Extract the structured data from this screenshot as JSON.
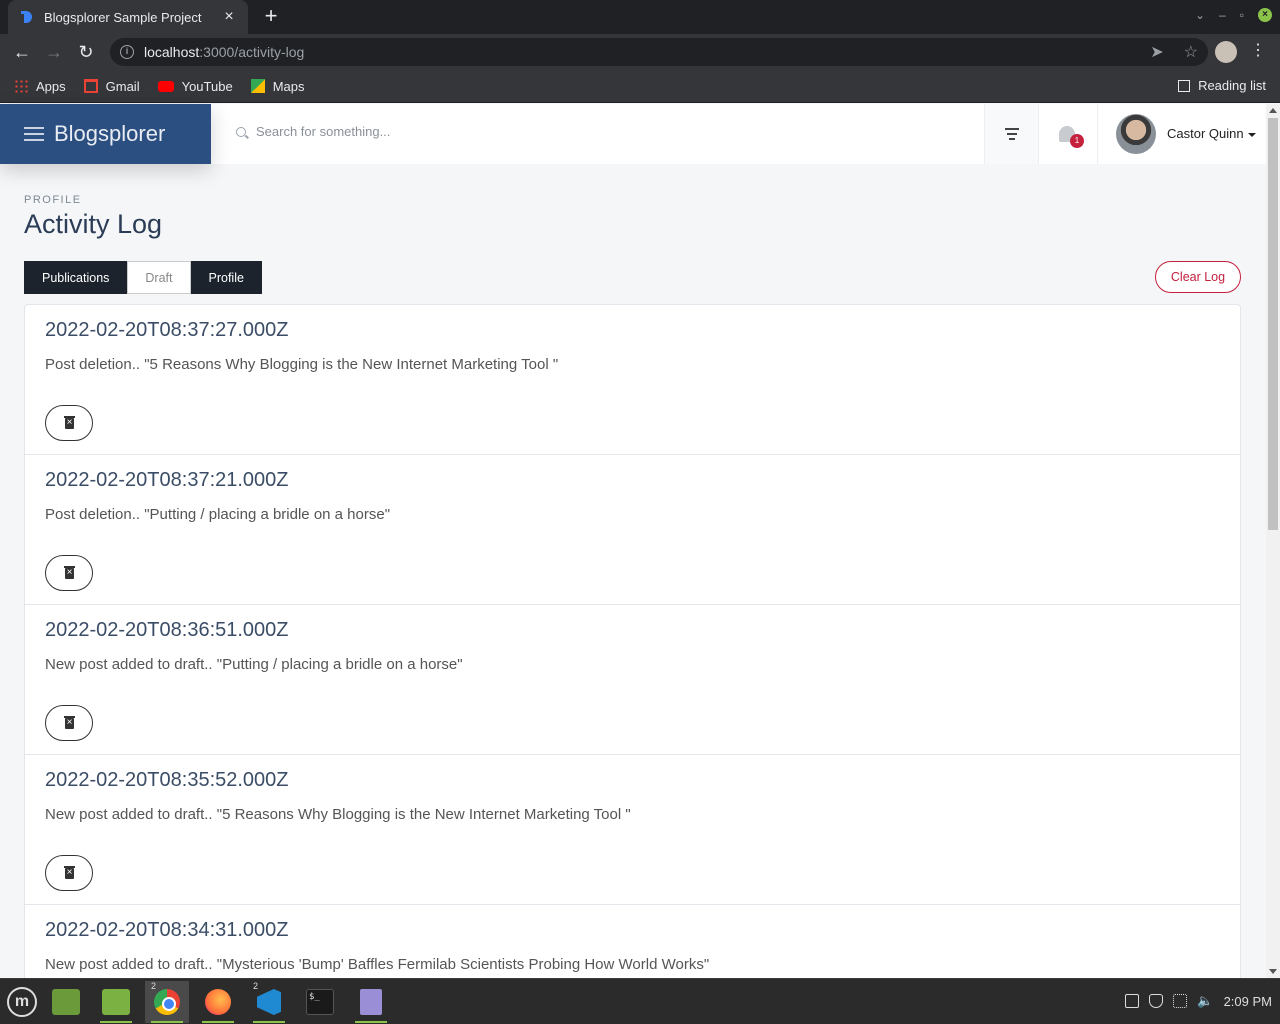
{
  "browser": {
    "tab_title": "Blogsplorer Sample Project",
    "url_host": "localhost",
    "url_rest": ":3000/activity-log",
    "bookmarks": [
      "Apps",
      "Gmail",
      "YouTube",
      "Maps"
    ],
    "reading_list": "Reading list"
  },
  "app": {
    "brand": "Blogsplorer",
    "search_placeholder": "Search for something...",
    "notification_count": "1",
    "user_name": "Castor Quinn"
  },
  "page": {
    "eyebrow": "PROFILE",
    "title": "Activity Log",
    "tabs": [
      "Publications",
      "Draft",
      "Profile"
    ],
    "clear_log": "Clear Log"
  },
  "log": [
    {
      "time": "2022-02-20T08:37:27.000Z",
      "message": "Post deletion.. \"5 Reasons Why Blogging is the New Internet Marketing Tool \""
    },
    {
      "time": "2022-02-20T08:37:21.000Z",
      "message": "Post deletion.. \"Putting / placing a bridle on a horse\""
    },
    {
      "time": "2022-02-20T08:36:51.000Z",
      "message": "New post added to draft.. \"Putting / placing a bridle on a horse\""
    },
    {
      "time": "2022-02-20T08:35:52.000Z",
      "message": "New post added to draft.. \"5 Reasons Why Blogging is the New Internet Marketing Tool \""
    },
    {
      "time": "2022-02-20T08:34:31.000Z",
      "message": "New post added to draft.. \"Mysterious 'Bump' Baffles Fermilab Scientists Probing How World Works\""
    }
  ],
  "taskbar": {
    "chrome_badge": "2",
    "vscode_badge": "2",
    "clock": "2:09 PM"
  },
  "colors": {
    "brand_bg": "#2c4f82",
    "danger": "#c5203e",
    "dark_tab": "#1d232d"
  }
}
